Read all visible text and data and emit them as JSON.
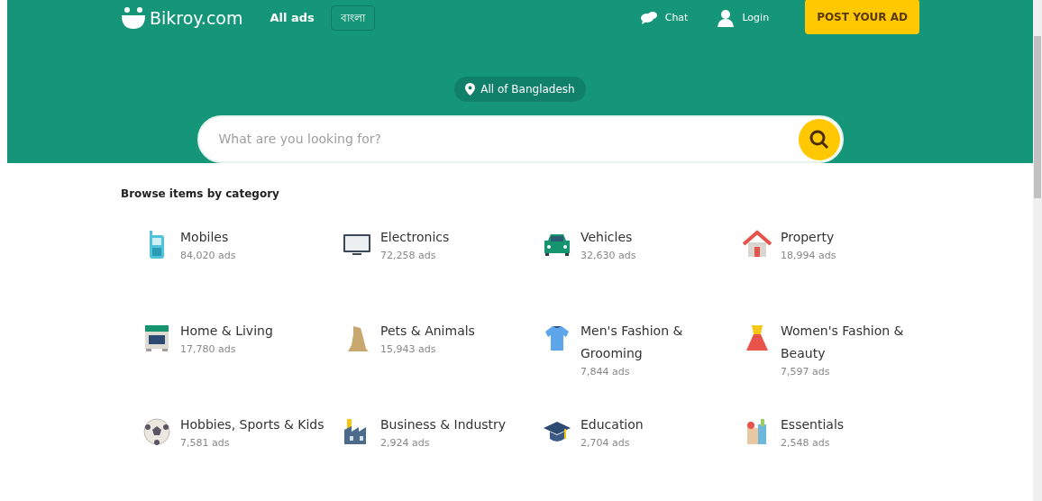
{
  "header": {
    "logo": "Bikroy.com",
    "nav_link": "All ads",
    "language_button": "বাংলা",
    "chat": "Chat",
    "login": "Login",
    "post_button": "POST YOUR AD"
  },
  "location": "All of Bangladesh",
  "search": {
    "placeholder": "What are you looking for?"
  },
  "categories_title": "Browse items by category",
  "categories": [
    {
      "name": "Mobiles",
      "count": "84,020 ads"
    },
    {
      "name": "Electronics",
      "count": "72,258 ads"
    },
    {
      "name": "Vehicles",
      "count": "32,630 ads"
    },
    {
      "name": "Property",
      "count": "18,994 ads"
    },
    {
      "name": "Home & Living",
      "count": "17,780 ads"
    },
    {
      "name": "Pets & Animals",
      "count": "15,943 ads"
    },
    {
      "name": "Men's Fashion & Grooming",
      "count": "7,844 ads"
    },
    {
      "name": "Women's Fashion & Beauty",
      "count": "7,597 ads"
    },
    {
      "name": "Hobbies, Sports & Kids",
      "count": "7,581 ads"
    },
    {
      "name": "Business & Industry",
      "count": "2,924 ads"
    },
    {
      "name": "Education",
      "count": "2,704 ads"
    },
    {
      "name": "Essentials",
      "count": "2,548 ads"
    }
  ]
}
